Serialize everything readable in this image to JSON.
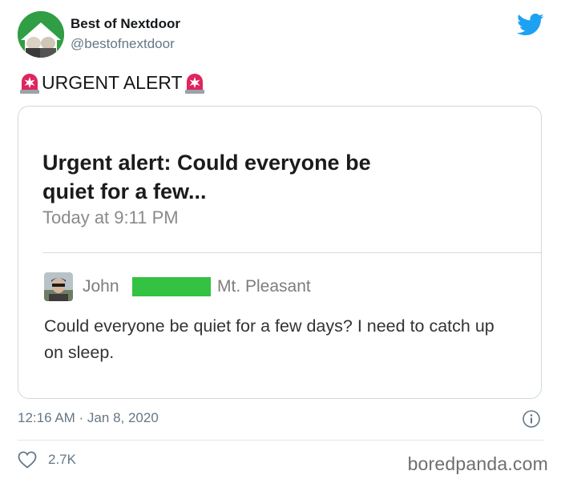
{
  "author": {
    "display_name": "Best of Nextdoor",
    "handle": "@bestofnextdoor",
    "avatar_icon": "muppet-avatar-icon"
  },
  "tweet": {
    "text": "URGENT ALERT",
    "emoji_icon": "police-siren-icon",
    "timestamp": "12:16 AM · Jan 8, 2020",
    "like_count": "2.7K"
  },
  "card": {
    "headline": "Urgent alert: Could everyone be quiet for a few...",
    "time": "Today at 9:11 PM",
    "post": {
      "author_name": "John",
      "location": "Mt. Pleasant",
      "body": "Could everyone be quiet for a few days? I need to catch up on sleep."
    }
  },
  "watermark": "boredpanda.com",
  "colors": {
    "twitter_blue": "#1da1f2",
    "redaction_green": "#33c241",
    "avatar_green": "#2f9e44",
    "siren_red": "#e0245e"
  }
}
